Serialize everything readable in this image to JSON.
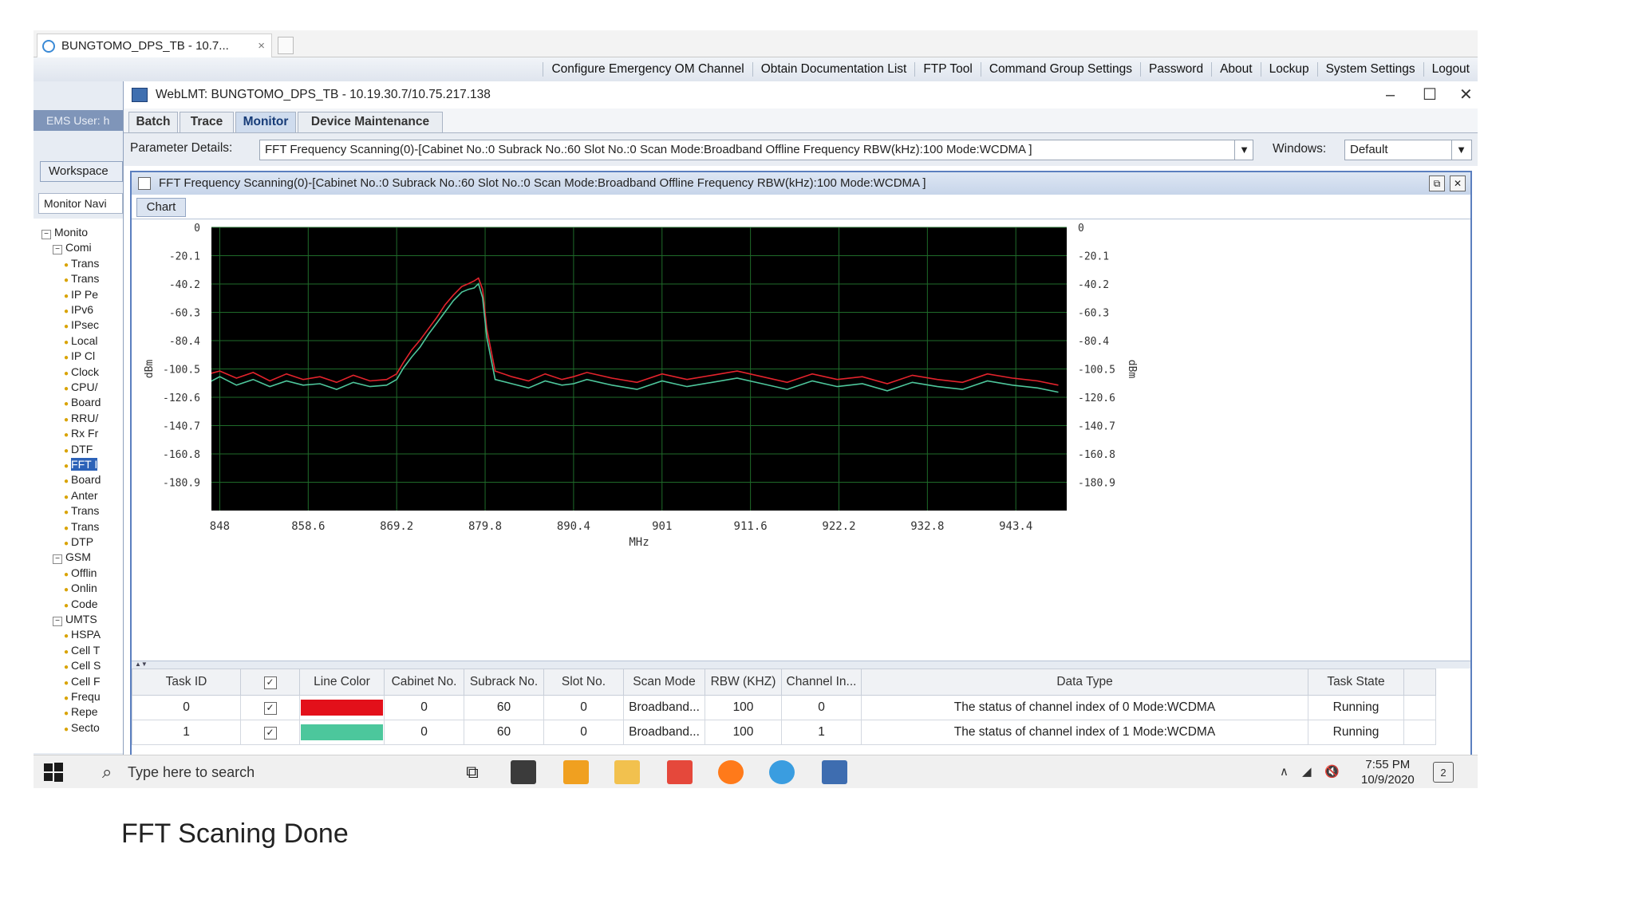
{
  "browser": {
    "tab_title": "BUNGTOMO_DPS_TB - 10.7...",
    "tab_close": "×"
  },
  "topbar": {
    "links": [
      "Configure Emergency OM Channel",
      "Obtain Documentation List",
      "FTP Tool",
      "Command Group Settings",
      "Password",
      "About",
      "Lockup",
      "System Settings",
      "Logout"
    ]
  },
  "left": {
    "ems_user": "EMS User: h",
    "workspace": "Workspace",
    "monitor_nav": "Monitor Navi",
    "tree": [
      {
        "label": "Monito",
        "level": 0,
        "expander": "−"
      },
      {
        "label": "Comi",
        "level": 1,
        "expander": "−"
      },
      {
        "label": "Trans",
        "level": 2
      },
      {
        "label": "Trans",
        "level": 2
      },
      {
        "label": "IP Pe",
        "level": 2
      },
      {
        "label": "IPv6",
        "level": 2
      },
      {
        "label": "IPsec",
        "level": 2
      },
      {
        "label": "Local",
        "level": 2
      },
      {
        "label": "IP Cl",
        "level": 2
      },
      {
        "label": "Clock",
        "level": 2
      },
      {
        "label": "CPU/",
        "level": 2
      },
      {
        "label": "Board",
        "level": 2
      },
      {
        "label": "RRU/",
        "level": 2
      },
      {
        "label": "Rx Fr",
        "level": 2
      },
      {
        "label": "DTF",
        "level": 2
      },
      {
        "label": "FFT I",
        "level": 2,
        "selected": true
      },
      {
        "label": "Board",
        "level": 2
      },
      {
        "label": "Anter",
        "level": 2
      },
      {
        "label": "Trans",
        "level": 2
      },
      {
        "label": "Trans",
        "level": 2
      },
      {
        "label": "DTP",
        "level": 2
      },
      {
        "label": "GSM",
        "level": 1,
        "expander": "−"
      },
      {
        "label": "Offlin",
        "level": 2
      },
      {
        "label": "Onlin",
        "level": 2
      },
      {
        "label": "Code",
        "level": 2
      },
      {
        "label": "UMTS",
        "level": 1,
        "expander": "−"
      },
      {
        "label": "HSPA",
        "level": 2
      },
      {
        "label": "Cell T",
        "level": 2
      },
      {
        "label": "Cell S",
        "level": 2
      },
      {
        "label": "Cell F",
        "level": 2
      },
      {
        "label": "Frequ",
        "level": 2
      },
      {
        "label": "Repe",
        "level": 2
      },
      {
        "label": "Secto",
        "level": 2
      }
    ]
  },
  "window": {
    "title": "WebLMT: BUNGTOMO_DPS_TB - 10.19.30.7/10.75.217.138",
    "tabs": [
      "Batch",
      "Trace",
      "Monitor",
      "Device Maintenance"
    ],
    "active_tab": "Monitor",
    "param_label": "Parameter Details:",
    "param_value": "FFT Frequency Scanning(0)-[Cabinet No.:0 Subrack No.:60 Slot No.:0 Scan Mode:Broadband Offline Frequency RBW(kHz):100 Mode:WCDMA ]",
    "windows_label": "Windows:",
    "windows_value": "Default",
    "inner_title": "FFT Frequency Scanning(0)-[Cabinet No.:0 Subrack No.:60 Slot No.:0 Scan Mode:Broadband Offline Frequency RBW(kHz):100 Mode:WCDMA ]",
    "chart_tab": "Chart"
  },
  "chart_data": {
    "type": "line",
    "xlabel": "MHz",
    "ylabel": "dBm",
    "y2label": "dBm",
    "xticks": [
      "848",
      "858.6",
      "869.2",
      "879.8",
      "890.4",
      "901",
      "911.6",
      "922.2",
      "932.8",
      "943.4"
    ],
    "yticks": [
      "0",
      "-20.1",
      "-40.2",
      "-60.3",
      "-80.4",
      "-100.5",
      "-120.6",
      "-140.7",
      "-160.8",
      "-180.9"
    ],
    "xlim": [
      847,
      949.5
    ],
    "ylim": [
      -201,
      0
    ],
    "grid": true,
    "background": "#000000",
    "grid_color": "#1f6b2a",
    "series": [
      {
        "color": "#e3232c",
        "x": [
          846.7,
          848,
          850,
          852,
          854,
          856,
          858,
          860,
          862,
          864,
          866,
          868,
          869.2,
          870,
          871,
          872,
          873,
          874,
          875,
          876,
          877,
          877.8,
          878.5,
          879,
          879.5,
          880,
          881,
          883,
          885,
          887,
          889,
          890.4,
          892,
          895,
          898,
          901,
          904,
          907,
          910,
          913,
          916,
          919,
          922,
          925,
          928,
          931,
          934,
          937,
          940,
          943,
          946,
          948.5
        ],
        "y": [
          -104,
          -102,
          -107,
          -103,
          -109,
          -104,
          -108,
          -106,
          -110,
          -105,
          -109,
          -108,
          -104,
          -96,
          -87,
          -80,
          -72,
          -64,
          -55,
          -48,
          -42,
          -40,
          -38,
          -36,
          -44,
          -72,
          -102,
          -106,
          -109,
          -104,
          -108,
          -106,
          -103,
          -107,
          -110,
          -104,
          -108,
          -105,
          -102,
          -106,
          -110,
          -104,
          -108,
          -106,
          -111,
          -105,
          -108,
          -110,
          -104,
          -107,
          -109,
          -112
        ]
      },
      {
        "color": "#4ec79c",
        "x": [
          846.7,
          848,
          850,
          852,
          854,
          856,
          858,
          860,
          862,
          864,
          866,
          868,
          869.2,
          870,
          871,
          872,
          873,
          874,
          875,
          876,
          877,
          877.8,
          878.5,
          879,
          879.5,
          880,
          881,
          883,
          885,
          887,
          889,
          890.4,
          892,
          895,
          898,
          901,
          904,
          907,
          910,
          913,
          916,
          919,
          922,
          925,
          928,
          931,
          934,
          937,
          940,
          943,
          946,
          948.5
        ],
        "y": [
          -110,
          -106,
          -112,
          -108,
          -113,
          -109,
          -112,
          -111,
          -115,
          -110,
          -113,
          -112,
          -108,
          -100,
          -92,
          -85,
          -76,
          -68,
          -60,
          -52,
          -46,
          -44,
          -43,
          -40,
          -50,
          -78,
          -108,
          -111,
          -114,
          -109,
          -112,
          -111,
          -108,
          -112,
          -115,
          -109,
          -113,
          -110,
          -107,
          -111,
          -115,
          -109,
          -113,
          -111,
          -116,
          -110,
          -113,
          -115,
          -109,
          -112,
          -114,
          -117
        ]
      }
    ]
  },
  "table": {
    "headers": [
      "Task ID",
      "☑",
      "Line Color",
      "Cabinet No.",
      "Subrack No.",
      "Slot No.",
      "Scan Mode",
      "RBW (KHZ)",
      "Channel In...",
      "Data Type",
      "Task State"
    ],
    "rows": [
      {
        "task_id": "0",
        "checked": "✓",
        "color": "#e3101a",
        "cabinet": "0",
        "subrack": "60",
        "slot": "0",
        "scan_mode": "Broadband...",
        "rbw": "100",
        "channel": "0",
        "data_type": "The status of channel index of 0 Mode:WCDMA",
        "state": "Running"
      },
      {
        "task_id": "1",
        "checked": "✓",
        "color": "#4cc79c",
        "cabinet": "0",
        "subrack": "60",
        "slot": "0",
        "scan_mode": "Broadband...",
        "rbw": "100",
        "channel": "1",
        "data_type": "The status of channel index of 1 Mode:WCDMA",
        "state": "Running"
      }
    ]
  },
  "taskbar": {
    "search_placeholder": "Type here to search",
    "time": "7:55 PM",
    "date": "10/9/2020",
    "notification_count": "2"
  },
  "caption": "FFT Scaning Done"
}
